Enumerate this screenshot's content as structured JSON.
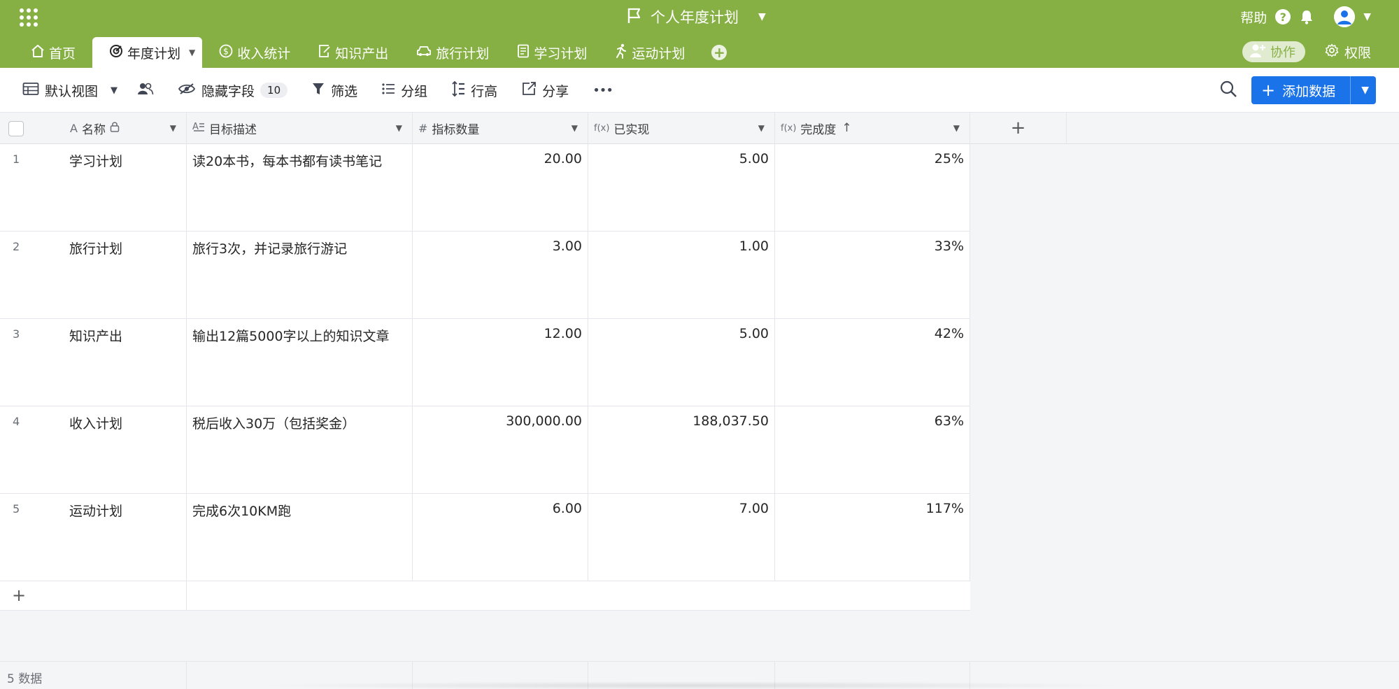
{
  "colors": {
    "accent": "#86b043",
    "primary": "#1a73e8"
  },
  "header": {
    "apps_icon": "grid-apps-icon",
    "doc_title": "个人年度计划",
    "help_label": "帮助"
  },
  "tabs": [
    {
      "label": "首页",
      "icon": "home-icon"
    },
    {
      "label": "年度计划",
      "icon": "target-icon",
      "active": true
    },
    {
      "label": "收入统计",
      "icon": "dollar-icon"
    },
    {
      "label": "知识产出",
      "icon": "doc-edit-icon"
    },
    {
      "label": "旅行计划",
      "icon": "car-icon"
    },
    {
      "label": "学习计划",
      "icon": "notebook-icon"
    },
    {
      "label": "运动计划",
      "icon": "running-icon"
    }
  ],
  "tab_right": {
    "collab_label": "协作",
    "perm_label": "权限"
  },
  "toolbar": {
    "view_label": "默认视图",
    "hidden_fields_label": "隐藏字段",
    "hidden_fields_count": "10",
    "filter_label": "筛选",
    "group_label": "分组",
    "row_height_label": "行高",
    "share_label": "分享",
    "more_label": "•••",
    "add_data_label": "添加数据"
  },
  "columns": [
    {
      "label": "名称"
    },
    {
      "label": "目标描述"
    },
    {
      "label": "指标数量"
    },
    {
      "label": "已实现"
    },
    {
      "label": "完成度"
    }
  ],
  "rows": [
    {
      "num": "1",
      "name": "学习计划",
      "desc": "读20本书，每本书都有读书笔记",
      "target": "20.00",
      "done": "5.00",
      "pct": "25%"
    },
    {
      "num": "2",
      "name": "旅行计划",
      "desc": "旅行3次，并记录旅行游记",
      "target": "3.00",
      "done": "1.00",
      "pct": "33%"
    },
    {
      "num": "3",
      "name": "知识产出",
      "desc": "输出12篇5000字以上的知识文章",
      "target": "12.00",
      "done": "5.00",
      "pct": "42%"
    },
    {
      "num": "4",
      "name": "收入计划",
      "desc": "税后收入30万（包括奖金）",
      "target": "300,000.00",
      "done": "188,037.50",
      "pct": "63%"
    },
    {
      "num": "5",
      "name": "运动计划",
      "desc": "完成6次10KM跑",
      "target": "6.00",
      "done": "7.00",
      "pct": "117%"
    }
  ],
  "footer": {
    "count_label": "5 数据"
  }
}
